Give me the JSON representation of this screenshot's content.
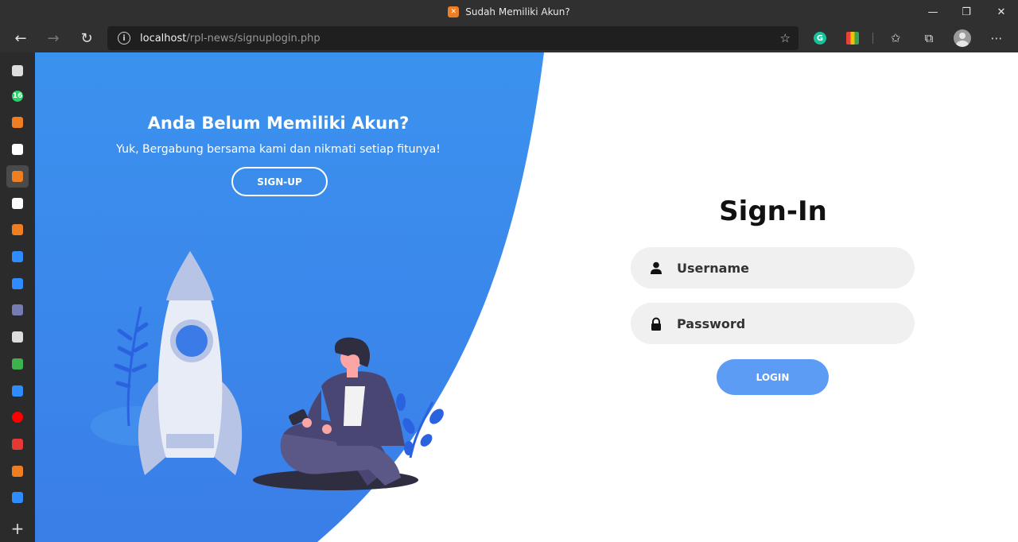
{
  "window": {
    "title": "Sudah Memiliki Akun?",
    "favicon_icon": "xampp-icon",
    "controls": [
      "minimize",
      "restore",
      "close"
    ]
  },
  "toolbar": {
    "url_host": "localhost",
    "url_path": "/rpl-news/signuplogin.php"
  },
  "sidebar": {
    "items": [
      {
        "icon": "tab-actions-icon",
        "color": "#dddddd"
      },
      {
        "icon": "whatsapp-icon",
        "color": "#25d366",
        "badge": "16"
      },
      {
        "icon": "app-icon-orange",
        "color": "#ef7d21"
      },
      {
        "icon": "github-icon",
        "color": "#ffffff"
      },
      {
        "icon": "xampp-icon",
        "color": "#ef7d21",
        "active": true
      },
      {
        "icon": "l-app-icon",
        "color": "#ffffff"
      },
      {
        "icon": "app-icon-orange-2",
        "color": "#ef7d21"
      },
      {
        "icon": "bing-icon",
        "color": "#2f8cff"
      },
      {
        "icon": "bing-icon",
        "color": "#2f8cff"
      },
      {
        "icon": "php-icon",
        "color": "#777bb3"
      },
      {
        "icon": "document-icon",
        "color": "#dddddd"
      },
      {
        "icon": "w-app-icon",
        "color": "#3cb44b"
      },
      {
        "icon": "bing-icon",
        "color": "#2f8cff"
      },
      {
        "icon": "youtube-icon",
        "color": "#ff0000"
      },
      {
        "icon": "pdf-icon",
        "color": "#e53935"
      },
      {
        "icon": "xampp-icon",
        "color": "#ef7d21"
      },
      {
        "icon": "bing-icon",
        "color": "#2f8cff"
      }
    ]
  },
  "left_panel": {
    "title": "Anda Belum Memiliki Akun?",
    "subtitle": "Yuk, Bergabung bersama kami dan nikmati setiap fitunya!",
    "signup_label": "SIGN-UP",
    "gradient_top": "#3b92ee",
    "gradient_bottom": "#3a7ee8"
  },
  "signin": {
    "title": "Sign-In",
    "username_placeholder": "Username",
    "password_placeholder": "Password",
    "login_label": "LOGIN",
    "accent": "#5c9cf5"
  }
}
